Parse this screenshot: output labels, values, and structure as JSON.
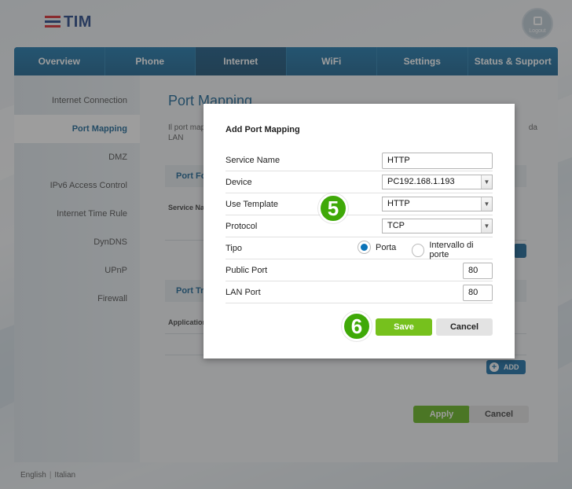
{
  "header": {
    "logo_text": "TIM",
    "logout_label": "Logout"
  },
  "nav": {
    "tabs": [
      {
        "label": "Overview"
      },
      {
        "label": "Phone"
      },
      {
        "label": "Internet"
      },
      {
        "label": "WiFi"
      },
      {
        "label": "Settings"
      },
      {
        "label": "Status & Support"
      }
    ],
    "active": "Internet"
  },
  "sidebar": {
    "items": [
      {
        "label": "Internet Connection"
      },
      {
        "label": "Port Mapping"
      },
      {
        "label": "DMZ"
      },
      {
        "label": "IPv6 Access Control"
      },
      {
        "label": "Internet Time Rule"
      },
      {
        "label": "DynDNS"
      },
      {
        "label": "UPnP"
      },
      {
        "label": "Firewall"
      }
    ],
    "active": "Port Mapping"
  },
  "main": {
    "title": "Port Mapping",
    "desc_start": "Il port map",
    "desc_end": "da",
    "desc_line2": "LAN",
    "section1": "Port Fo",
    "col_service": "Service Na",
    "section2": "Port Tr",
    "col_application": "Application",
    "add_label": "ADD",
    "apply_label": "Apply",
    "cancel_label": "Cancel"
  },
  "footer": {
    "lang_english": "English",
    "lang_italian": "Italian"
  },
  "modal": {
    "title": "Add Port Mapping",
    "service_name": {
      "label": "Service Name",
      "value": "HTTP"
    },
    "device": {
      "label": "Device",
      "value": "PC192.168.1.193"
    },
    "use_template": {
      "label": "Use Template",
      "value": "HTTP"
    },
    "protocol": {
      "label": "Protocol",
      "value": "TCP"
    },
    "tipo": {
      "label": "Tipo",
      "option1": "Porta",
      "option2": "Intervallo di porte",
      "selected": "Porta"
    },
    "public_port": {
      "label": "Public Port",
      "value": "80"
    },
    "lan_port": {
      "label": "LAN Port",
      "value": "80"
    },
    "save_label": "Save",
    "cancel_label": "Cancel"
  },
  "steps": {
    "step5": "5",
    "step6": "6"
  },
  "colors": {
    "brand_blue": "#0b5b8e",
    "save_green": "#76c11d",
    "step_green": "#3fa908",
    "tim_red": "#d71a21"
  }
}
